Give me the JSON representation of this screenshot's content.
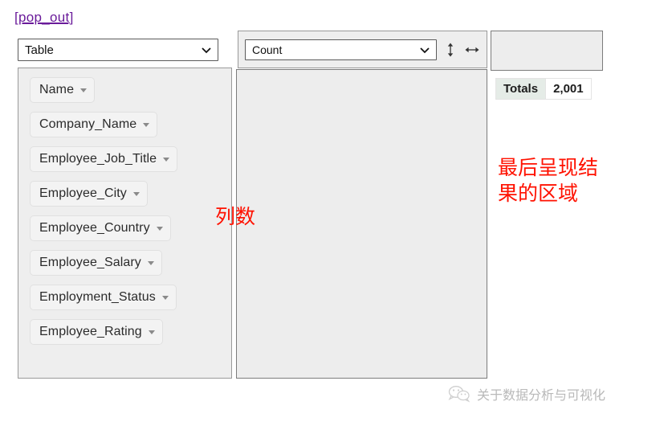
{
  "popout": {
    "label": "[pop_out]"
  },
  "left_panel": {
    "chart_type_select": {
      "value": "Table",
      "icon": "chevron-down-icon"
    },
    "fields": [
      {
        "label": "Name",
        "icon": "triangle-down-icon"
      },
      {
        "label": "Company_Name",
        "icon": "triangle-down-icon"
      },
      {
        "label": "Employee_Job_Title",
        "icon": "triangle-down-icon"
      },
      {
        "label": "Employee_City",
        "icon": "triangle-down-icon"
      },
      {
        "label": "Employee_Country",
        "icon": "triangle-down-icon"
      },
      {
        "label": "Employee_Salary",
        "icon": "triangle-down-icon"
      },
      {
        "label": "Employment_Status",
        "icon": "triangle-down-icon"
      },
      {
        "label": "Employee_Rating",
        "icon": "triangle-down-icon"
      }
    ]
  },
  "mid_panel": {
    "aggregate_select": {
      "value": "Count",
      "icon": "chevron-down-icon"
    },
    "resize_vertical_icon": "arrows-vertical-icon",
    "resize_horizontal_icon": "arrows-horizontal-icon"
  },
  "right_panel": {
    "totals": {
      "label": "Totals",
      "value": "2,001"
    }
  },
  "annotations": [
    {
      "name": "columns-count-note",
      "text": "列数"
    },
    {
      "name": "result-area-note",
      "text": "最后呈现结\n果的区域"
    }
  ],
  "watermark": {
    "text": "关于数据分析与可视化",
    "icon": "wechat-icon"
  },
  "colors": {
    "link": "#6a1b9a",
    "annotation": "#ff1100",
    "panel_bg": "#eeeeee",
    "totals_label_bg": "#e5ece7",
    "watermark": "#b9b9b9"
  }
}
